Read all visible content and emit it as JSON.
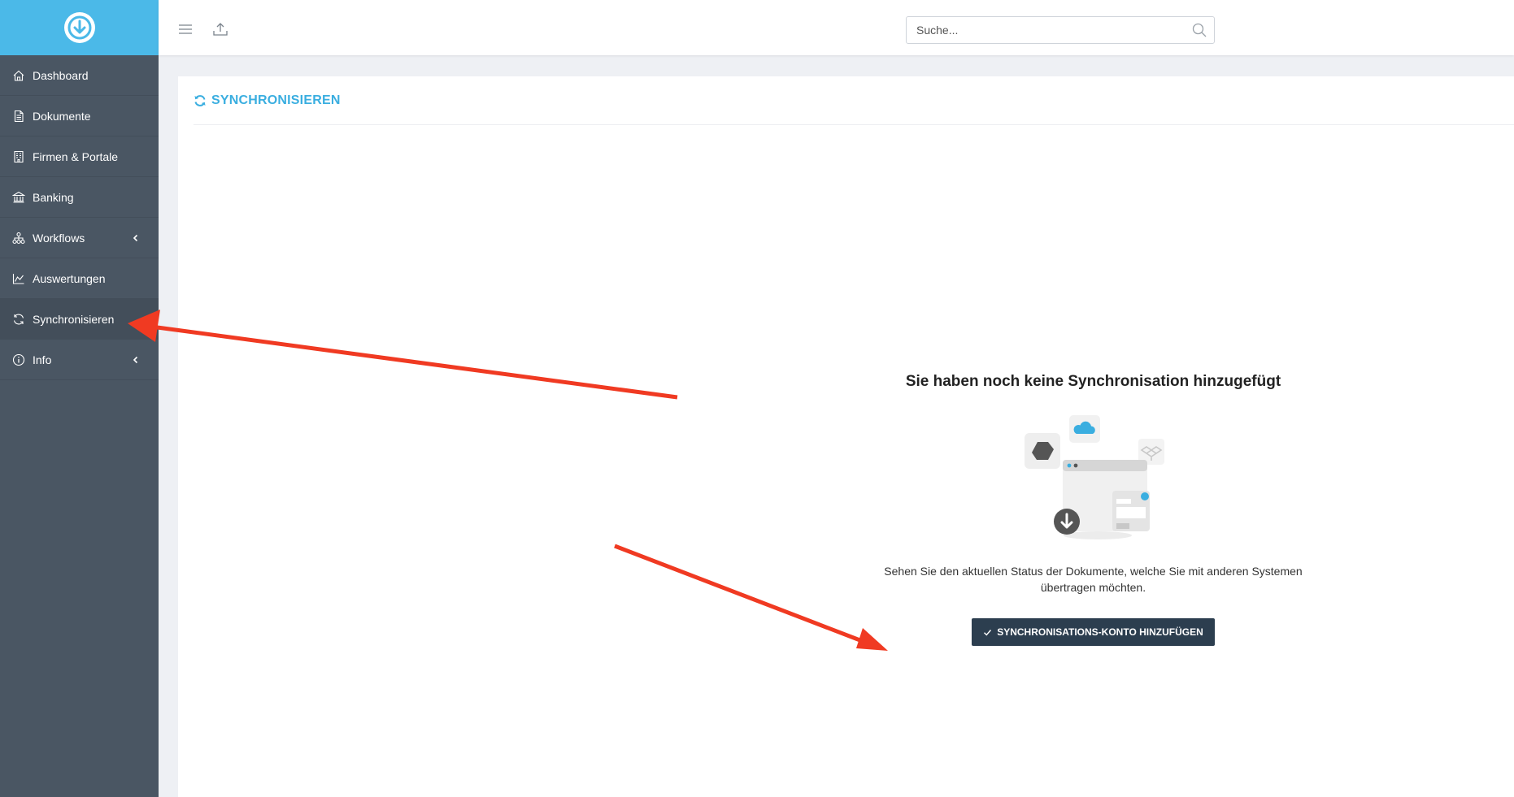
{
  "app": {
    "brand_color": "#4bb9e8",
    "sidebar_color": "#4a5663"
  },
  "sidebar": {
    "items": [
      {
        "label": "Dashboard",
        "icon": "home-icon"
      },
      {
        "label": "Dokumente",
        "icon": "document-icon"
      },
      {
        "label": "Firmen & Portale",
        "icon": "building-icon"
      },
      {
        "label": "Banking",
        "icon": "bank-icon"
      },
      {
        "label": "Workflows",
        "icon": "workflow-icon",
        "has_submenu": true
      },
      {
        "label": "Auswertungen",
        "icon": "chart-icon"
      },
      {
        "label": "Synchronisieren",
        "icon": "sync-icon",
        "active": true
      },
      {
        "label": "Info",
        "icon": "info-icon",
        "has_submenu": true
      }
    ]
  },
  "topbar": {
    "search_placeholder": "Suche..."
  },
  "page": {
    "title": "SYNCHRONISIEREN",
    "title_color": "#3aaee0"
  },
  "empty_state": {
    "heading": "Sie haben noch keine Synchronisation hinzugefügt",
    "description_line1": "Sehen Sie den aktuellen Status der Dokumente, welche Sie mit anderen Systemen",
    "description_line2": "übertragen möchten.",
    "button_label": "SYNCHRONISATIONS-KONTO HINZUFÜGEN",
    "button_color": "#2c3e4f"
  },
  "annotations": {
    "arrow_color": "#f03a22"
  }
}
